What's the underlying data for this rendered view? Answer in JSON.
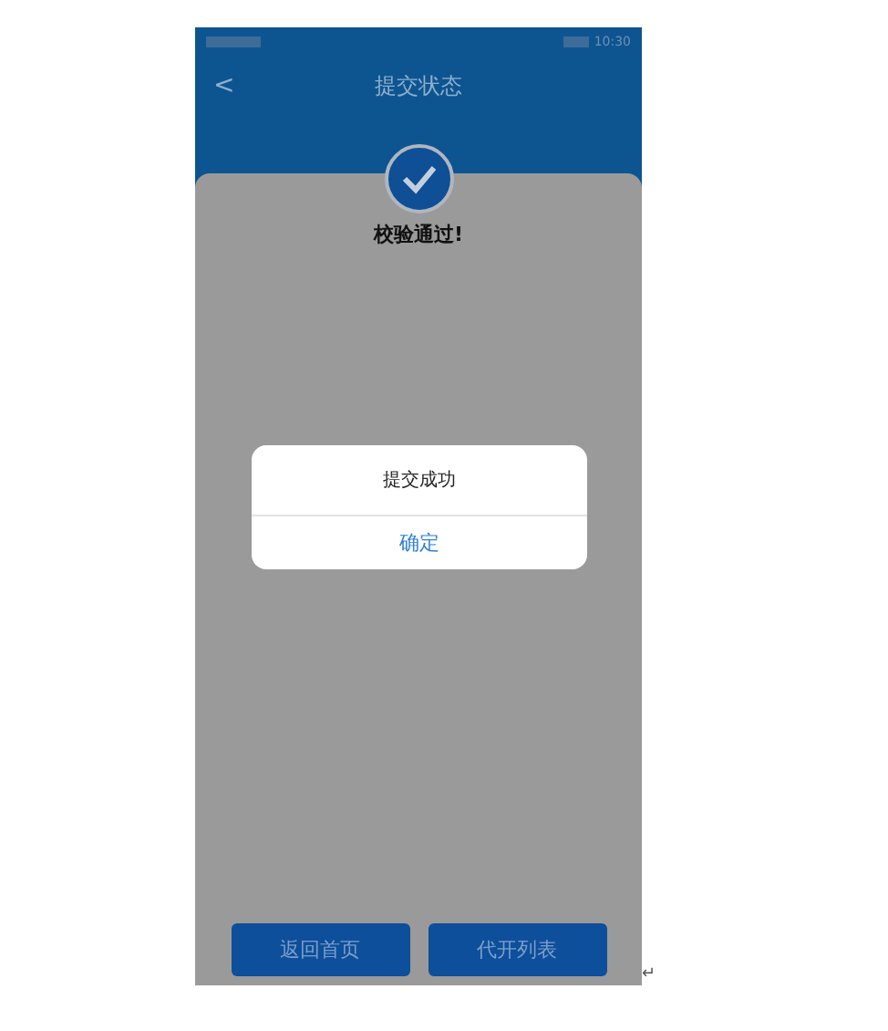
{
  "status_bar": {
    "time": "10:30"
  },
  "header": {
    "back": "<",
    "title": "提交状态"
  },
  "result": {
    "message": "校验通过!"
  },
  "dialog": {
    "message": "提交成功",
    "button": "确定"
  },
  "buttons": [
    {
      "label": "返回首页"
    },
    {
      "label": "代开列表"
    }
  ],
  "return_mark": "↵"
}
